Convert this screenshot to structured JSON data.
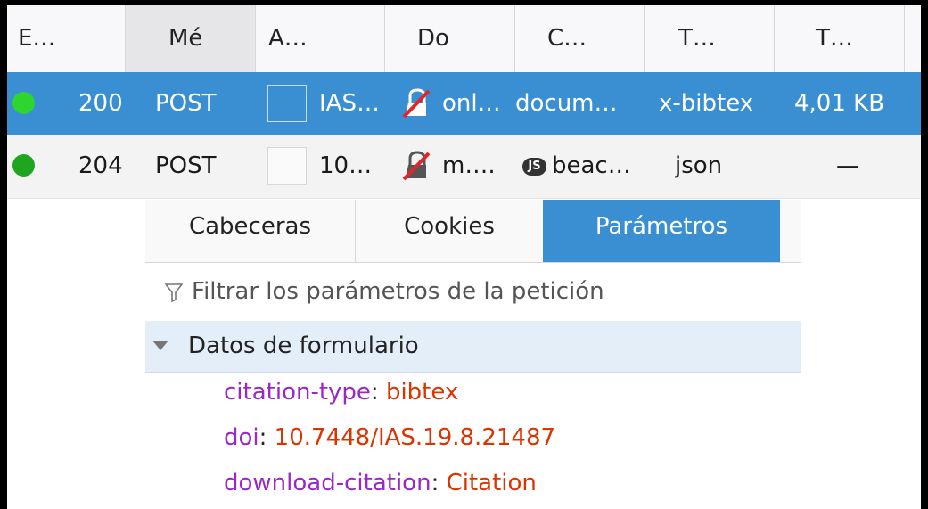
{
  "columns": [
    "E…",
    "Mé",
    "A…",
    "Do",
    "C…",
    "T…",
    "T…"
  ],
  "rows": [
    {
      "status": "200",
      "method": "POST",
      "domain": "IAS…",
      "file": "onl…",
      "cause": "docum…",
      "type": "x-bibtex",
      "size": "4,01 KB",
      "selected": true
    },
    {
      "status": "204",
      "method": "POST",
      "domain": "10…",
      "file": "m….",
      "cause_badge": "JS",
      "cause": "beac…",
      "type": "json",
      "size": "—",
      "selected": false
    }
  ],
  "details": {
    "tabs": [
      "Cabeceras",
      "Cookies",
      "Parámetros"
    ],
    "active_tab": "Parámetros",
    "filter_icon": "filter-icon",
    "filter_placeholder": "Filtrar los parámetros de la petición",
    "group_label": "Datos de formulario",
    "params": [
      {
        "key": "citation-type",
        "value": "bibtex"
      },
      {
        "key": "doi",
        "value": "10.7448/IAS.19.8.21487"
      },
      {
        "key": "download-citation",
        "value": "Citation"
      }
    ]
  },
  "colors": {
    "selected_row": "#3a8fd3",
    "status_ok": "#2ed52e",
    "param_key": "#9a28c7",
    "param_value": "#dd3300"
  }
}
